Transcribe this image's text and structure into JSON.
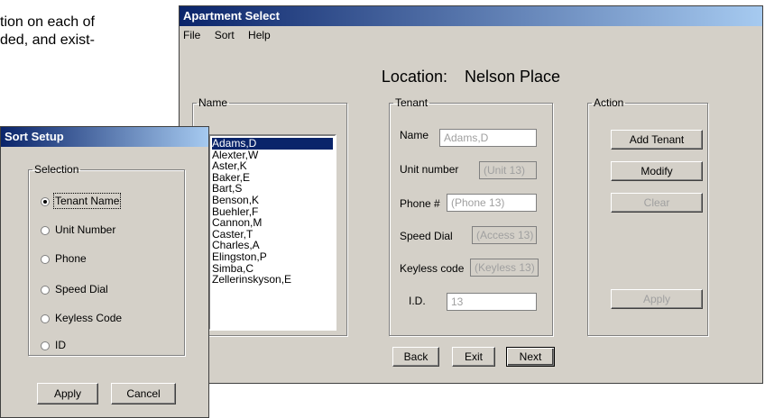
{
  "background_text": {
    "line1": "tion on each of",
    "line2": "ded, and exist-"
  },
  "main": {
    "title": "Apartment Select",
    "menu": [
      "File",
      "Sort",
      "Help"
    ],
    "location_label": "Location:",
    "location_value": "Nelson Place",
    "name_group": {
      "legend": "Name",
      "items": [
        "Adams,D",
        "Alexter,W",
        "Aster,K",
        "Baker,E",
        "Bart,S",
        "Benson,K",
        "Buehler,F",
        "Cannon,M",
        "Caster,T",
        "Charles,A",
        "Elingston,P",
        "Simba,C",
        "Zellerinskyson,E"
      ],
      "selected": "Adams,D"
    },
    "tenant_group": {
      "legend": "Tenant",
      "name_label": "Name",
      "name_value": "Adams,D",
      "unit_label": "Unit number",
      "unit_value": "(Unit 13)",
      "phone_label": "Phone #",
      "phone_value": "(Phone 13)",
      "speed_label": "Speed Dial",
      "speed_value": "(Access 13)",
      "keyless_label": "Keyless code",
      "keyless_value": "(Keyless 13)",
      "id_label": "I.D.",
      "id_value": "13"
    },
    "action_group": {
      "legend": "Action",
      "add_tenant": "Add Tenant",
      "modify": "Modify",
      "clear": "Clear",
      "apply": "Apply"
    },
    "nav": {
      "back": "Back",
      "exit": "Exit",
      "next": "Next"
    }
  },
  "sort": {
    "title": "Sort Setup",
    "legend": "Selection",
    "options": [
      "Tenant Name",
      "Unit Number",
      "Phone",
      "Speed Dial",
      "Keyless Code",
      "ID"
    ],
    "selected": "Tenant Name",
    "apply": "Apply",
    "cancel": "Cancel"
  },
  "colors": {
    "titlebar_start": "#0a246a",
    "titlebar_end": "#a6caf0",
    "window_face": "#d4d0c8",
    "selection": "#0a246a"
  }
}
